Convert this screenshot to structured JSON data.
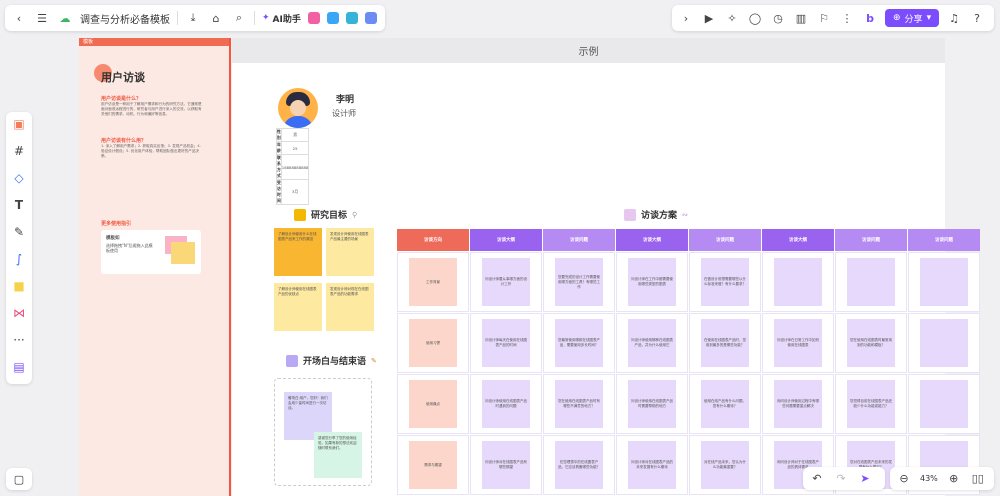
{
  "toolbar": {
    "title": "调查与分析必备模板",
    "ai_label": "AI助手",
    "share_label": "分享"
  },
  "doc": {
    "strip_label": "模板",
    "title": "用户访谈",
    "sections": [
      {
        "heading": "用户访谈是什么？",
        "text": "用户访谈是一种用于了解用户需求和行为的研究方法。它通常是面对面或远程进行的，研究者与用户进行深入的交流，以获取有关他们的需求、动机、行为和偏好等信息。"
      },
      {
        "heading": "用户访谈有什么用？",
        "text": "1. 深入了解用户需求；2. 获取真实反馈；3. 发现产品机会；4. 验证设计假设；5. 优化用户体验，帮助团队做出更好的产品决策。"
      },
      {
        "heading": "更多使用指引",
        "text": ""
      }
    ],
    "card_title": "模板如",
    "card_text": "选择拖拽\"N\"后缀拖入此模板使用"
  },
  "canvas_title": "示例",
  "profile": {
    "name": "李明",
    "role": "设计师",
    "rows": [
      {
        "k": "性别",
        "v": "男"
      },
      {
        "k": "年龄",
        "v": "25"
      },
      {
        "k": "联系方式",
        "v": "18888888888"
      },
      {
        "k": "受访时间",
        "v": "3月"
      }
    ]
  },
  "goals": {
    "title": "研究目标",
    "notes": [
      "了解设计师使用什么在线图表产品来工作的原因",
      "发现设计师使用在线图表产品最主要的场景",
      "了解设计师使用在线图表产品的优缺点",
      "发现设计师对现在在线图表产品的功能需求"
    ]
  },
  "opening": {
    "title": "开场白与结束语",
    "notes": [
      "暖场白:用户，您好！我们会用少量时间进行一次访谈。",
      "感谢您分享了您的使用经验，如果有新的想法欢迎随时联系我们。"
    ]
  },
  "plan": {
    "title": "访谈方案",
    "headers": [
      "访谈方向",
      "访谈大纲",
      "访谈问题",
      "访谈大纲",
      "访谈问题",
      "访谈大纲",
      "访谈问题"
    ],
    "rows": [
      {
        "dir": "工作背景",
        "cells": [
          "问设计师要从事哪方面的设计工作",
          "您要完成的设计工作需要使用哪方面的工具？有哪些工作",
          "问设计师在工作中都需要使用哪些类型的图表",
          "在做设计前想需要哪些以什么标准来做？有什么要求？",
          "",
          ""
        ]
      },
      {
        "dir": "使用习惯",
        "cells": [
          "问设计师每天在使用在线图表产品的时间",
          "您最常使用哪款在线图表产品，需要使用多长时间？",
          "问设计师使用哪种在线图表产品，并为什么使用它",
          "在使用在线图表产品时，您用到最多的是哪些功能？",
          "问设计师在日常工作中如何使用在线图表",
          "您在使用在线图表时最常用到的功能和模板？"
        ]
      },
      {
        "dir": "使用痛点",
        "cells": [
          "问设计师使用在线图表产品时遇到的问题",
          "您在使用在线图表产品时有哪些不满意的地方？",
          "问设计师使用在线图表产品时需要帮助的地方",
          "使用在线产品有什么问题，您有什么期待？",
          "询问设计师使用过程中有哪些问题需要重点解决",
          "您觉得目前在线图表产品还缺少什么功能或能力？"
        ]
      },
      {
        "dir": "需求与期望",
        "cells": [
          "问设计师对在线图表产品有哪些期望",
          "在您理想中的在线图表产品，它应该具备哪些功能？",
          "问设计师对在线图表产品的未来发展有什么期待",
          "对在线产品未来，您认为什么功能最重要？",
          "询问设计师对于在线图表产品的具体需求",
          "您对在线图表产品未来的发展有什么建议？"
        ]
      }
    ]
  },
  "zoom": "43%"
}
